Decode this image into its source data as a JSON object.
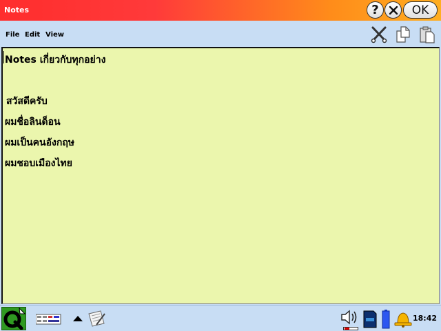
{
  "window": {
    "title": "Notes",
    "help_label": "?",
    "ok_label": "OK"
  },
  "menu": {
    "file": "File",
    "edit": "Edit",
    "view": "View"
  },
  "toolbar_icons": [
    "cut-icon",
    "copy-icon",
    "paste-icon"
  ],
  "document": {
    "lines": [
      "Notes เกี่ยวกับทุกอย่าง",
      "สวัสดีครับ",
      "ผมชื่อลินด็อน",
      "ผมเป็นคนอังกฤษ",
      "ผมชอบเมืองไทย"
    ]
  },
  "taskbar": {
    "clock": "18:42",
    "volume_level": 0.35,
    "icons": [
      "start-icon",
      "applications-icon",
      "arrow-up-icon",
      "notes-task-icon",
      "speaker-icon",
      "sd-card-icon",
      "battery-icon",
      "alarm-bell-icon"
    ]
  },
  "colors": {
    "title_gradient_start": "#ff2d2d",
    "title_gradient_end": "#ffae20",
    "toolbar_bg": "#c8ddf4",
    "editor_bg": "#ebf6ad",
    "start_button": "#2f9a21"
  }
}
